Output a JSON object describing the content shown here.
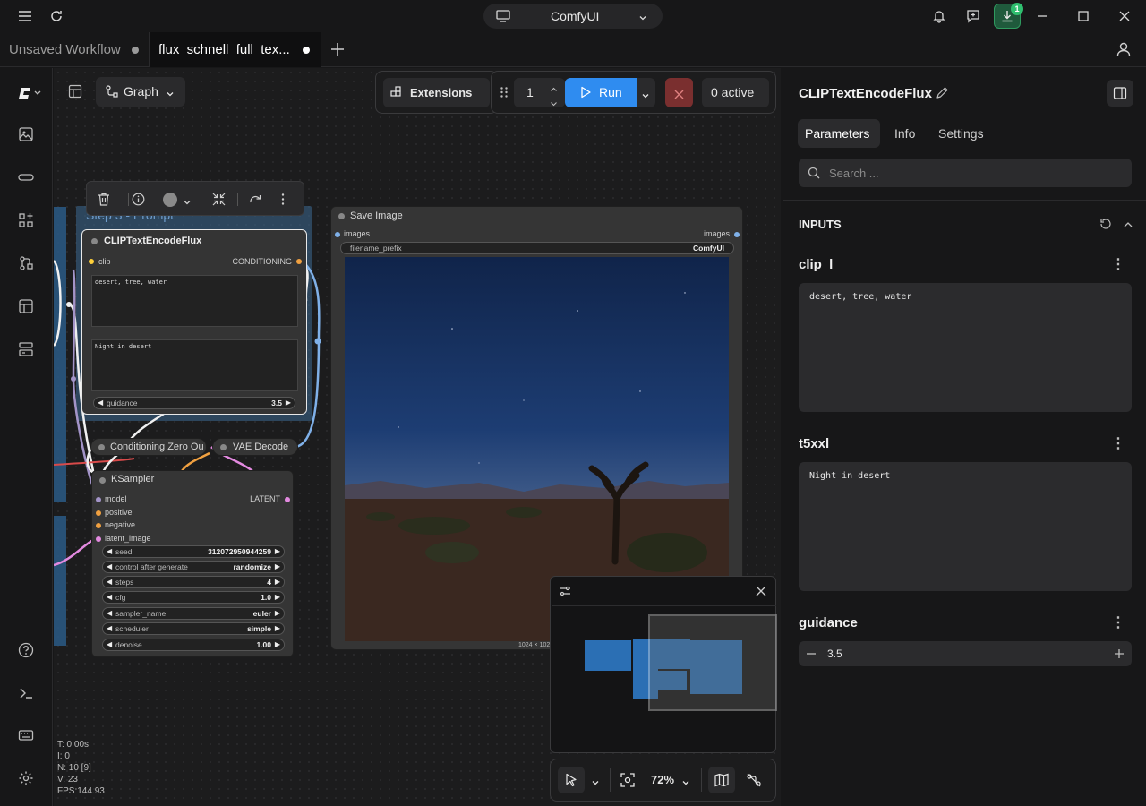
{
  "app": {
    "name": "ComfyUI",
    "download_badge": "1"
  },
  "tabs": [
    {
      "label": "Unsaved Workflow",
      "active": false
    },
    {
      "label": "flux_schnell_full_tex...",
      "active": true
    }
  ],
  "toolbar": {
    "graph_label": "Graph",
    "extensions_label": "Extensions",
    "queue_count": "1",
    "run_label": "Run",
    "active_label": "0 active"
  },
  "canvas": {
    "group_title": "Step 3 - Prompt",
    "clip_node": {
      "title": "CLIPTextEncodeFlux",
      "input_clip": "clip",
      "output": "CONDITIONING",
      "text_clip_l": "desert, tree, water",
      "text_t5xxl": "Night in desert",
      "guidance_label": "guidance",
      "guidance_value": "3.5"
    },
    "cond_zero_title": "Conditioning Zero Ou",
    "vae_decode_title": "VAE Decode",
    "ksampler": {
      "title": "KSampler",
      "inputs": [
        "model",
        "positive",
        "negative",
        "latent_image"
      ],
      "output": "LATENT",
      "widgets": [
        {
          "label": "seed",
          "value": "312072950944259"
        },
        {
          "label": "control after generate",
          "value": "randomize"
        },
        {
          "label": "steps",
          "value": "4"
        },
        {
          "label": "cfg",
          "value": "1.0"
        },
        {
          "label": "sampler_name",
          "value": "euler"
        },
        {
          "label": "scheduler",
          "value": "simple"
        },
        {
          "label": "denoise",
          "value": "1.00"
        }
      ]
    },
    "save_image": {
      "title": "Save Image",
      "input": "images",
      "output": "images",
      "prefix_label": "filename_prefix",
      "prefix_value": "ComfyUI",
      "dims": "1024 × 1024"
    },
    "stats": {
      "t": "T: 0.00s",
      "i": "I: 0",
      "n": "N: 10 [9]",
      "v": "V: 23",
      "fps": "FPS:144.93"
    },
    "zoom": "72%"
  },
  "right_panel": {
    "title": "CLIPTextEncodeFlux",
    "tabs": [
      "Parameters",
      "Info",
      "Settings"
    ],
    "search_placeholder": "Search ...",
    "section_title": "INPUTS",
    "clip_l_label": "clip_l",
    "clip_l_value": "desert, tree, water",
    "t5xxl_label": "t5xxl",
    "t5xxl_value": "Night in desert",
    "guidance_label": "guidance",
    "guidance_value": "3.5"
  },
  "colors": {
    "accent_blue": "#2f8cf0",
    "cancel_red": "#7a2f2f",
    "download_green": "#1f7a4a"
  }
}
